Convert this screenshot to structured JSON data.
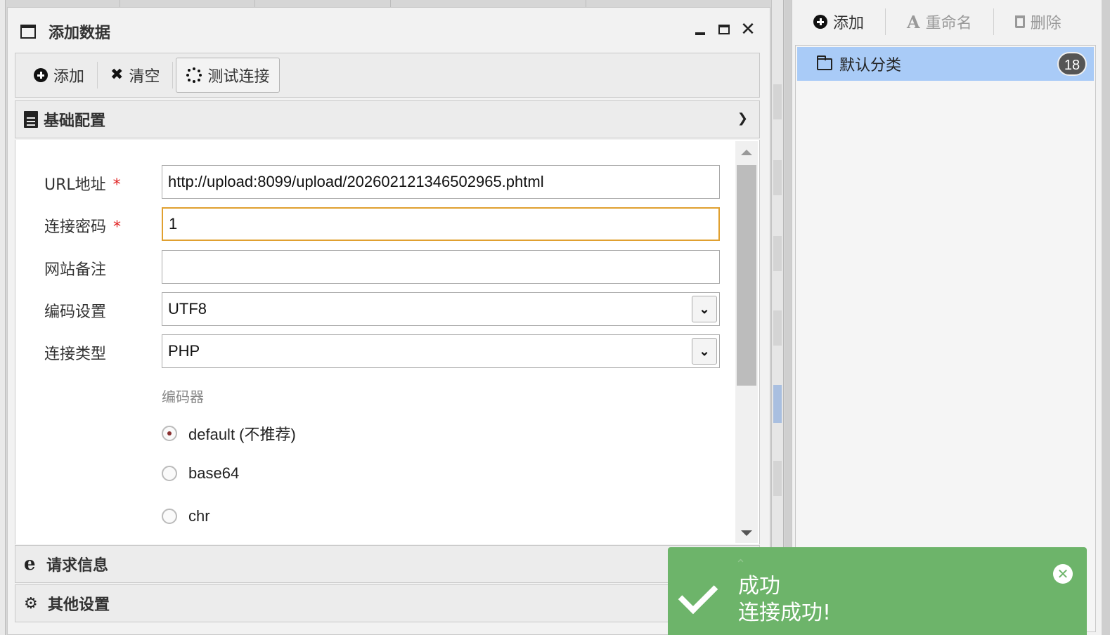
{
  "dialog": {
    "title": "添加数据",
    "toolbar": {
      "add_label": "添加",
      "clear_label": "清空",
      "test_label": "测试连接"
    },
    "sections": {
      "basic": "基础配置",
      "request": "请求信息",
      "other": "其他设置"
    },
    "form": {
      "url_label": "URL地址",
      "url_value": "http://upload:8099/upload/202602121346502965.phtml",
      "password_label": "连接密码",
      "password_value": "1",
      "note_label": "网站备注",
      "note_value": "",
      "required_mark": "*",
      "encoding_label": "编码设置",
      "encoding_value": "UTF8",
      "type_label": "连接类型",
      "type_value": "PHP",
      "encoder_title": "编码器",
      "encoders": [
        {
          "label": "default (不推荐)",
          "checked": true
        },
        {
          "label": "base64",
          "checked": false
        },
        {
          "label": "chr",
          "checked": false
        }
      ]
    }
  },
  "right_panel": {
    "toolbar": {
      "add_label": "添加",
      "rename_label": "重命名",
      "delete_label": "删除"
    },
    "categories": [
      {
        "name": "默认分类",
        "count": "18"
      }
    ]
  },
  "toast": {
    "title": "成功",
    "message": "连接成功!",
    "color": "#6db46a"
  },
  "colors": {
    "accent_focus": "#e0a030",
    "selected_row": "#a9cbf7",
    "required": "#e02020"
  }
}
